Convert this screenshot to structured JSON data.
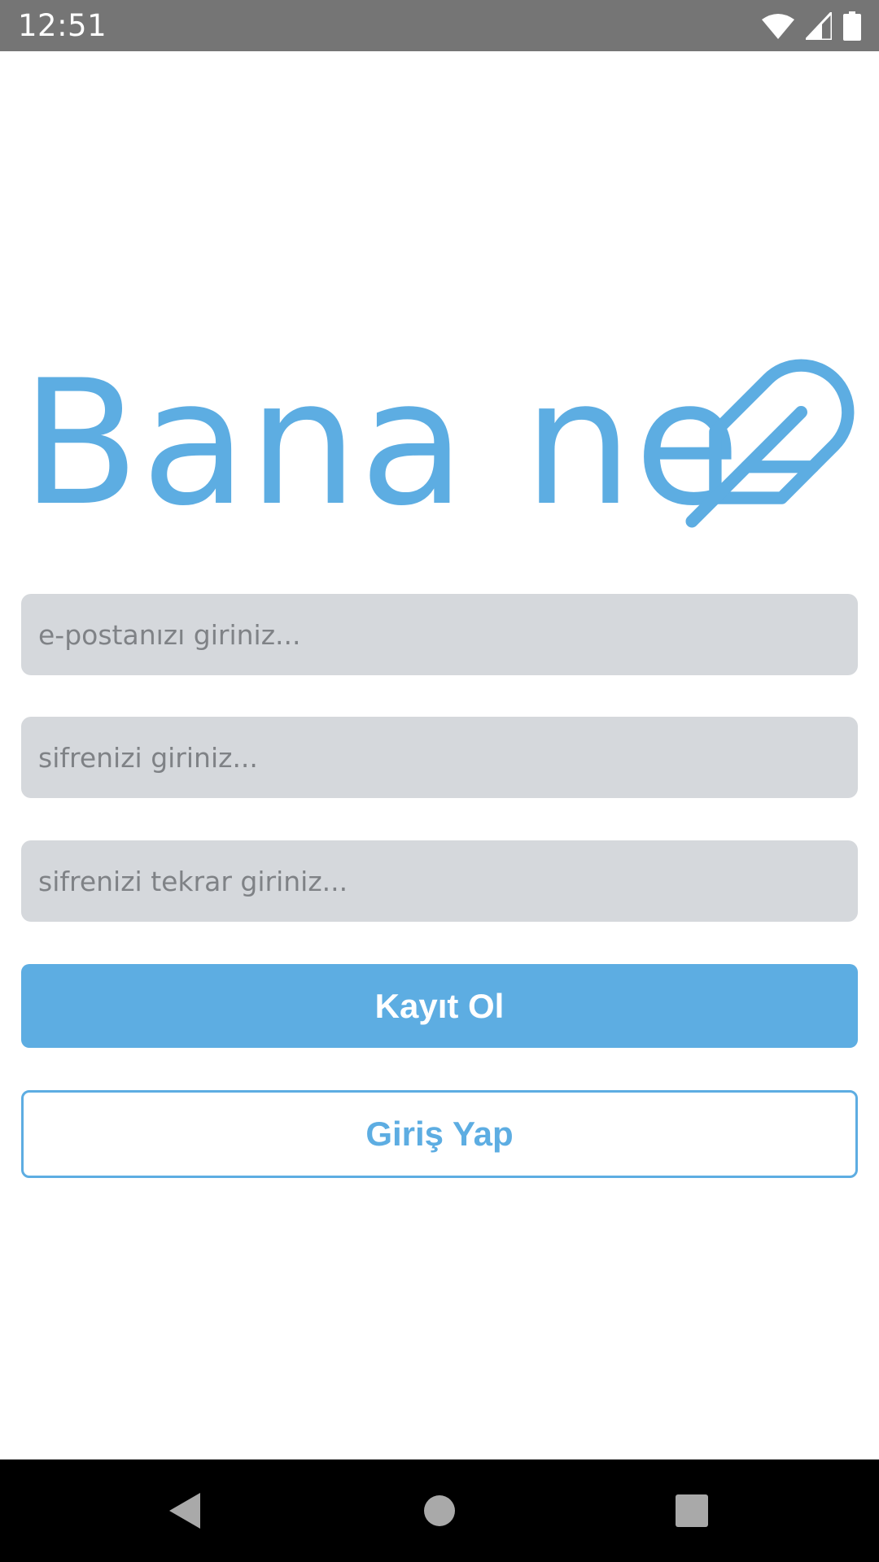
{
  "status_bar": {
    "time": "12:51",
    "icons": [
      "wifi-icon",
      "cell-signal-icon",
      "battery-icon"
    ]
  },
  "logo": {
    "text": "Bana ne",
    "icon": "feather-icon",
    "color": "#5dade2"
  },
  "form": {
    "email": {
      "placeholder": "e-postanızı giriniz...",
      "value": ""
    },
    "password": {
      "placeholder": "sifrenizi giriniz...",
      "value": ""
    },
    "password_repeat": {
      "placeholder": "sifrenizi tekrar giriniz...",
      "value": ""
    }
  },
  "buttons": {
    "register_label": "Kayıt Ol",
    "login_label": "Giriş Yap"
  },
  "nav_bar": {
    "icons": [
      "back-icon",
      "home-icon",
      "recents-icon"
    ]
  },
  "colors": {
    "accent": "#5dade2",
    "field_background": "#d5d8dc",
    "status_bar": "#757575",
    "nav_bar": "#000000"
  }
}
